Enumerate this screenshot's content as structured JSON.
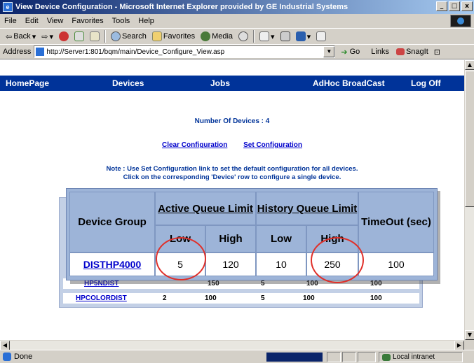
{
  "window": {
    "title": "View Device Configuration - Microsoft Internet Explorer provided by GE Industrial Systems",
    "minimize_glyph": "_",
    "maximize_glyph": "□",
    "close_glyph": "x"
  },
  "menu": [
    "File",
    "Edit",
    "View",
    "Favorites",
    "Tools",
    "Help"
  ],
  "toolbar": {
    "back": "Back",
    "search": "Search",
    "favorites": "Favorites",
    "media": "Media"
  },
  "address": {
    "label": "Address",
    "url": "http://Server1:801/bqm/main/Device_Configure_View.asp",
    "go": "Go",
    "links": "Links",
    "snagit": "SnagIt"
  },
  "site_nav": [
    "HomePage",
    "Devices",
    "Jobs",
    "AdHoc BroadCast",
    "Log Off"
  ],
  "content": {
    "device_count": "Number Of Devices : 4",
    "clear_link": "Clear Configuration",
    "set_link": "Set Configuration",
    "note_line1": "Note : Use Set Configuration link to set the default configuration for all devices.",
    "note_line2": "Click on the corresponding 'Device' row to configure a single device."
  },
  "underlying_rows": [
    {
      "group": "HP5NDIST",
      "low": "",
      "high": "150",
      "hist_low": "5",
      "hist_high": "100",
      "timeout": "100"
    },
    {
      "group": "HPCOLORDIST",
      "low": "2",
      "high": "100",
      "hist_low": "5",
      "hist_high": "100",
      "timeout": "100"
    }
  ],
  "zoom_table": {
    "headers": {
      "device_group": "Device Group",
      "active_queue": "Active Queue Limit",
      "history_queue": "History Queue Limit",
      "timeout": "TimeOut (sec)",
      "low": "Low",
      "high": "High"
    },
    "row": {
      "group": "DISTHP4000",
      "active_low": "5",
      "active_high": "120",
      "history_low": "10",
      "history_high": "250",
      "timeout": "100"
    }
  },
  "status": {
    "text": "Done",
    "zone": "Local intranet"
  },
  "colors": {
    "nav_bg": "#003399",
    "table_header": "#9db4d8",
    "highlight_circle": "#e0302a",
    "link": "#0000cc"
  }
}
